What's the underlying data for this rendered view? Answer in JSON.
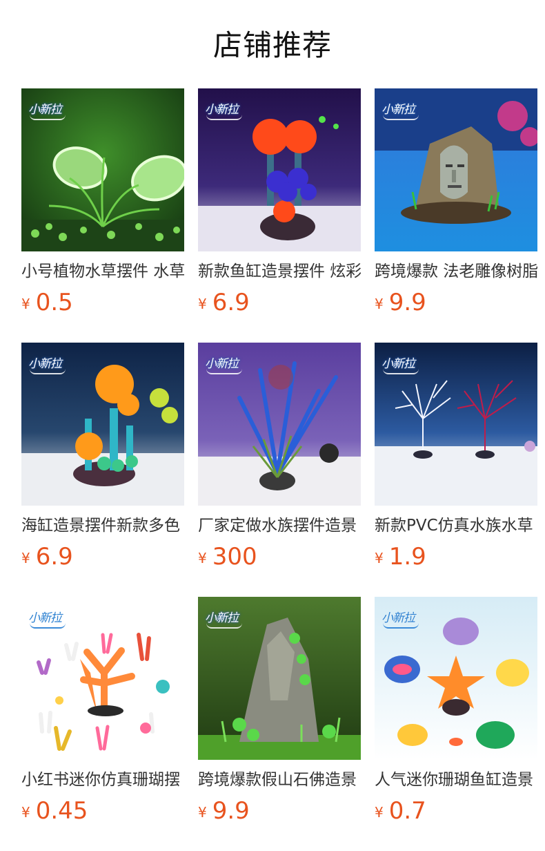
{
  "page": {
    "title": "店铺推荐"
  },
  "logo_text": "小新拉",
  "colors": {
    "price": "#e8531e",
    "title_text": "#111111",
    "item_text": "#333333"
  },
  "products": [
    {
      "title": "小号植物水草摆件 水草",
      "currency": "¥",
      "price": "0.5"
    },
    {
      "title": "新款鱼缸造景摆件 炫彩",
      "currency": "¥",
      "price": "6.9"
    },
    {
      "title": "跨境爆款 法老雕像树脂",
      "currency": "¥",
      "price": "9.9"
    },
    {
      "title": "海缸造景摆件新款多色",
      "currency": "¥",
      "price": "6.9"
    },
    {
      "title": "厂家定做水族摆件造景",
      "currency": "¥",
      "price": "300"
    },
    {
      "title": "新款PVC仿真水族水草",
      "currency": "¥",
      "price": "1.9"
    },
    {
      "title": "小红书迷你仿真珊瑚摆",
      "currency": "¥",
      "price": "0.45"
    },
    {
      "title": "跨境爆款假山石佛造景",
      "currency": "¥",
      "price": "9.9"
    },
    {
      "title": "人气迷你珊瑚鱼缸造景",
      "currency": "¥",
      "price": "0.7"
    }
  ]
}
